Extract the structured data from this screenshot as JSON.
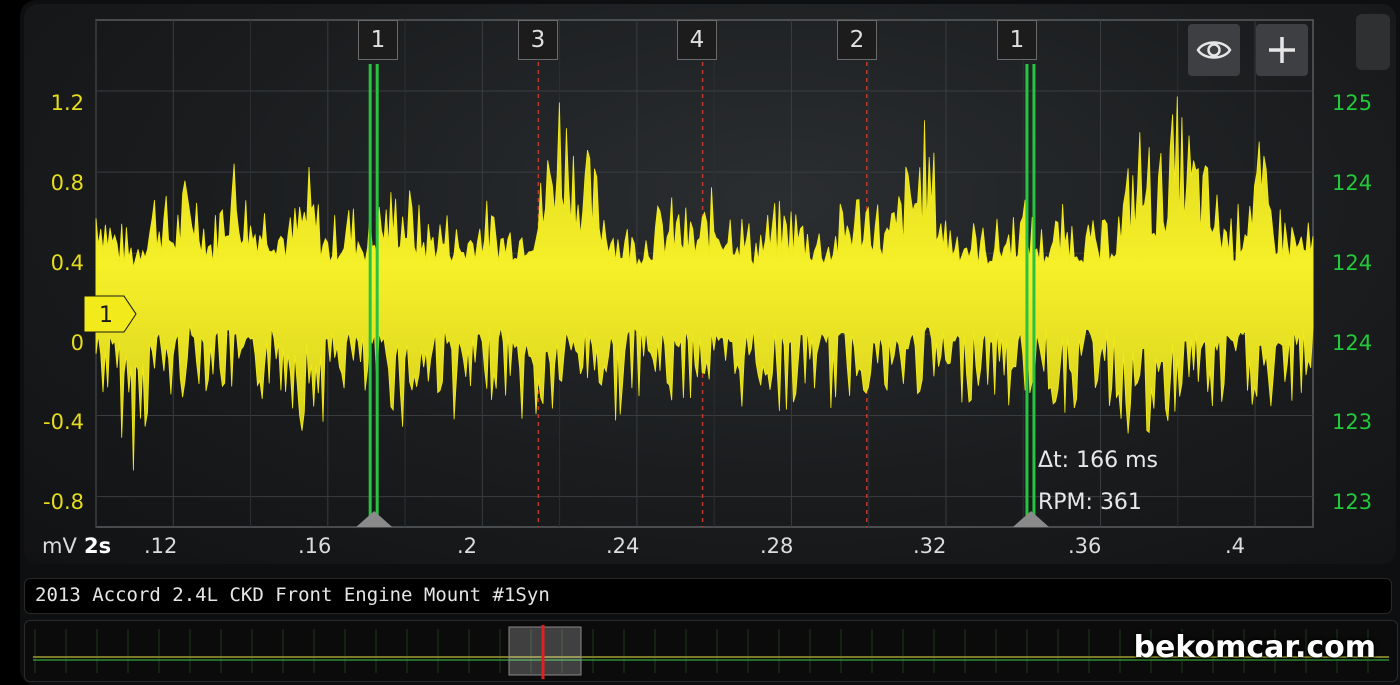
{
  "left_axis": {
    "unit_label": "mV",
    "ticks": [
      "1.2",
      "0.8",
      "0.4",
      "0",
      "-0.4",
      "-0.8"
    ]
  },
  "right_axis": {
    "ticks": [
      "125",
      "124",
      "124",
      "124",
      "123",
      "123"
    ]
  },
  "time_axis": {
    "unit_label": "2s",
    "ticks": [
      ".12",
      ".16",
      ".2",
      ".24",
      ".28",
      ".32",
      ".36",
      ".4"
    ]
  },
  "cylinder_markers": [
    "1",
    "3",
    "4",
    "2",
    "1"
  ],
  "trigger_marker": "1",
  "measurement": {
    "delta_t": "Δt: 166 ms",
    "rpm": "RPM: 361"
  },
  "toolbar": {
    "eye_icon": "eye-icon",
    "add_icon": "plus-icon"
  },
  "capture_title": "2013 Accord 2.4L CKD Front Engine Mount #1Syn",
  "watermark": "bekomcar.com",
  "colors": {
    "trace": "#f2ea1a",
    "right_axis": "#22c93a",
    "cursor": "#27c441",
    "cylinder_line": "#c0392b",
    "overview_cursor": "#e02020"
  },
  "chart_data": {
    "type": "line",
    "title": "",
    "xlabel": "2s",
    "ylabel": "mV",
    "xlim": [
      0.1,
      0.415
    ],
    "ylim": [
      -0.95,
      1.55
    ],
    "cursors_x": [
      0.172,
      0.342
    ],
    "series": [
      {
        "x": [
          0.1,
          0.105,
          0.11,
          0.115,
          0.12,
          0.125,
          0.13,
          0.135,
          0.14,
          0.145,
          0.15,
          0.155,
          0.16,
          0.165,
          0.17,
          0.175,
          0.18,
          0.185,
          0.19,
          0.195,
          0.2,
          0.205,
          0.21,
          0.215,
          0.22,
          0.225,
          0.23,
          0.235,
          0.24,
          0.245,
          0.25,
          0.255,
          0.26,
          0.265,
          0.27,
          0.275,
          0.28,
          0.285,
          0.29,
          0.295,
          0.3,
          0.305,
          0.31,
          0.315,
          0.32,
          0.325,
          0.33,
          0.335,
          0.34,
          0.345,
          0.35,
          0.355,
          0.36,
          0.365,
          0.37,
          0.375,
          0.38,
          0.385,
          0.39,
          0.395,
          0.4,
          0.405,
          0.41,
          0.415
        ],
        "y_max": [
          0.85,
          0.6,
          0.5,
          0.8,
          0.65,
          0.9,
          0.55,
          1.0,
          0.7,
          0.75,
          0.6,
          0.85,
          0.55,
          0.7,
          0.6,
          0.75,
          0.8,
          0.6,
          0.65,
          0.55,
          0.7,
          0.6,
          0.65,
          0.8,
          1.4,
          1.0,
          0.85,
          0.6,
          0.55,
          0.65,
          0.7,
          0.6,
          0.75,
          0.7,
          0.55,
          0.65,
          0.7,
          0.6,
          0.55,
          0.75,
          0.8,
          0.6,
          0.9,
          1.1,
          0.65,
          0.6,
          0.55,
          0.6,
          0.7,
          0.55,
          0.65,
          0.6,
          0.55,
          0.7,
          1.1,
          0.9,
          1.2,
          1.0,
          0.75,
          0.6,
          1.05,
          0.7,
          0.6,
          0.55
        ],
        "y_min": [
          -0.3,
          -0.45,
          -0.7,
          -0.35,
          -0.4,
          -0.25,
          -0.3,
          -0.35,
          -0.45,
          -0.3,
          -0.35,
          -0.55,
          -0.4,
          -0.3,
          -0.45,
          -0.35,
          -0.5,
          -0.4,
          -0.3,
          -0.55,
          -0.35,
          -0.3,
          -0.45,
          -0.55,
          -0.4,
          -0.3,
          -0.35,
          -0.45,
          -0.3,
          -0.35,
          -0.4,
          -0.3,
          -0.35,
          -0.45,
          -0.3,
          -0.35,
          -0.45,
          -0.3,
          -0.4,
          -0.35,
          -0.3,
          -0.45,
          -0.35,
          -0.3,
          -0.4,
          -0.35,
          -0.3,
          -0.4,
          -0.35,
          -0.3,
          -0.45,
          -0.35,
          -0.3,
          -0.5,
          -0.55,
          -0.75,
          -0.4,
          -0.35,
          -0.5,
          -0.3,
          -0.4,
          -0.55,
          -0.35,
          -0.3
        ]
      }
    ]
  }
}
